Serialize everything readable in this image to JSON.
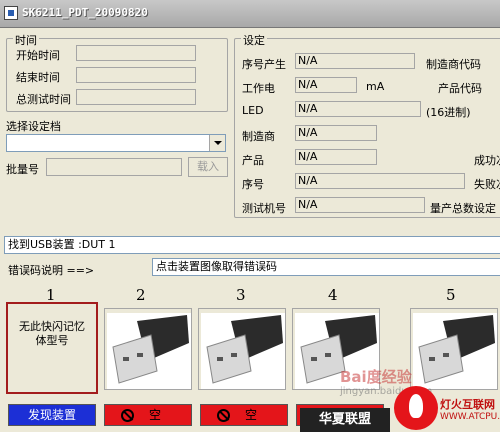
{
  "window": {
    "title": "SK6211_PDT_20090820"
  },
  "time_group": {
    "title": "时间",
    "start_label": "开始时间",
    "end_label": "结束时间",
    "total_label": "总测试时间",
    "start_value": "",
    "end_value": "",
    "total_value": ""
  },
  "select_group": {
    "title": "选择设定档",
    "selected": ""
  },
  "batch": {
    "label": "批量号",
    "value": "",
    "load_button": "载入"
  },
  "settings": {
    "title": "设定",
    "rows": [
      {
        "label": "序号产生",
        "value": "N/A",
        "right_label": "制造商代码"
      },
      {
        "label": "工作电",
        "value": "N/A",
        "unit": "mA",
        "right_label": "产品代码"
      },
      {
        "label": "LED",
        "value": "N/A",
        "suffix": "(16进制)"
      },
      {
        "label": "制造商",
        "value": "N/A"
      },
      {
        "label": "产品",
        "value": "N/A",
        "right_label": "成功次"
      },
      {
        "label": "序号",
        "value": "N/A",
        "right_label": "失败次"
      },
      {
        "label": "测试机号",
        "value": "N/A",
        "right_label": "量产总数设定"
      }
    ]
  },
  "status": {
    "found_text": "找到USB装置 :DUT 1",
    "error_label": "错误码说明 ==>",
    "error_hint": "点击装置图像取得错误码"
  },
  "slots": [
    {
      "number": "1",
      "state": "no-flash",
      "message": "无此快闪记忆体型号",
      "button": "发现装置",
      "button_color": "#1c2fd6"
    },
    {
      "number": "2",
      "state": "usb-image",
      "button": "空",
      "button_color": "#e4151a"
    },
    {
      "number": "3",
      "state": "usb-image",
      "button": "空",
      "button_color": "#e4151a"
    },
    {
      "number": "4",
      "state": "usb-image",
      "button": "",
      "button_color": "#e4151a"
    },
    {
      "number": "5",
      "state": "usb-image",
      "button": "",
      "button_color": "#e4151a"
    }
  ],
  "watermark": {
    "baidu": "Bai度经验",
    "baidu_sub": "jingyan.baidu.com",
    "banner": "华夏联盟",
    "site_name": "灯火互联网",
    "site_url": "WWW.ATCPU.COM"
  }
}
